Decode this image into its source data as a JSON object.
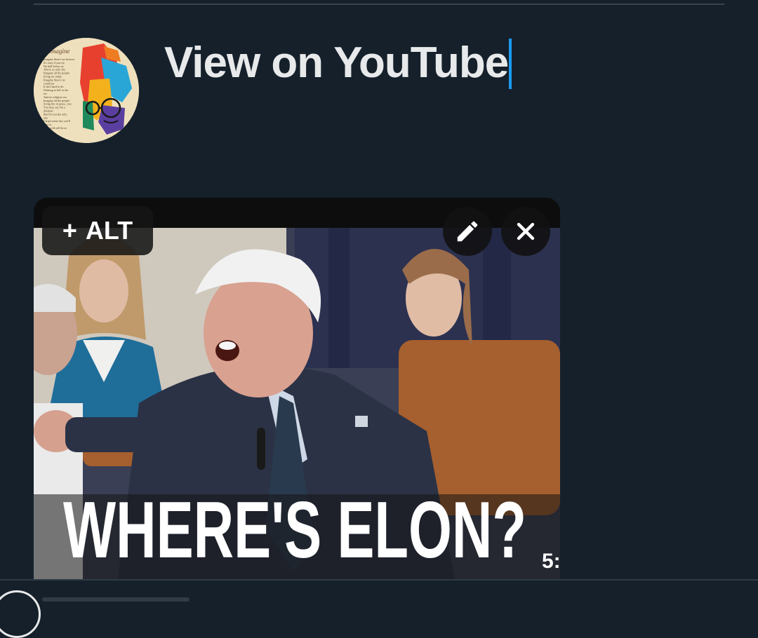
{
  "composer": {
    "text": "View on YouTube"
  },
  "avatar": {
    "title_text": "Imagine",
    "lyrics_lines": [
      "Imagine there's no heaven",
      "It's easy if you try",
      "No hell below us",
      "Above us only sky",
      "Imagine all the people",
      "living for today",
      "Imagine there's no",
      "countries",
      "It isn't hard to do",
      "Nothing to kill or die",
      "for",
      "And no religion too",
      "Imagine all the people",
      "living life in peace, you",
      "You may say I'm a",
      "dreamer",
      "But I'm not the only",
      "one",
      "I hope some day you'll",
      "join us",
      "the world will be as"
    ]
  },
  "media": {
    "alt_button_label": "ALT",
    "alt_plus_glyph": "+",
    "thumbnail_caption": "WHERE'S ELON?",
    "duration_text": "5:"
  },
  "colors": {
    "background": "#15202b",
    "caret": "#1d9bf0",
    "text": "#e7e9ea"
  },
  "icons": {
    "avatar": "avatar-image",
    "alt_add": "plus-icon",
    "edit": "pencil-icon",
    "remove": "close-icon"
  }
}
